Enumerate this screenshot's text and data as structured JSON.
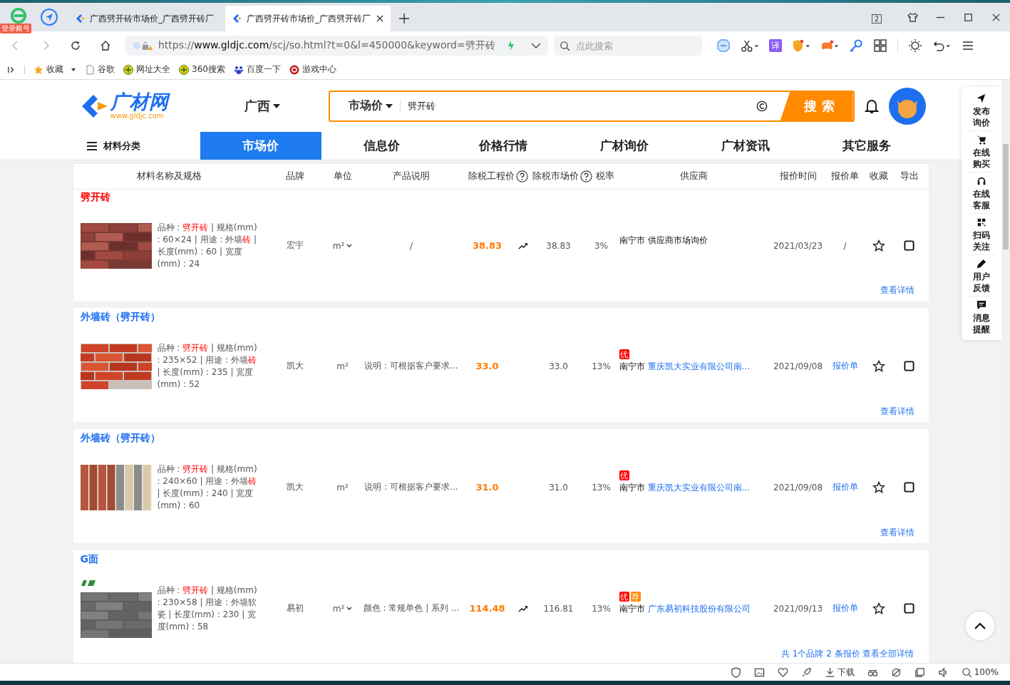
{
  "browser": {
    "login_badge": "登录账号",
    "tabs": [
      {
        "title": "广西劈开砖市场价_广西劈开砖厂",
        "selected": false
      },
      {
        "title": "广西劈开砖市场价_广西劈开砖厂",
        "selected": true
      }
    ],
    "tab_count": "2",
    "url_scheme": "https://",
    "url_host": "www.gldjc.com",
    "url_path": "/scj/so.html?t=0&l=450000&keyword=劈开砖",
    "search_placeholder": "点此搜索",
    "translate_glyph": "译",
    "bookmarks": [
      "收藏",
      "谷歌",
      "网址大全",
      "360搜索",
      "百度一下",
      "游戏中心"
    ]
  },
  "site": {
    "logo_name": "广材网",
    "logo_url": "www.gldjc.com",
    "region": "广西",
    "search_type": "市场价",
    "search_value": "劈开砖",
    "search_button": "搜 索",
    "nav": [
      {
        "label": "材料分类",
        "selected": false
      },
      {
        "label": "市场价",
        "selected": true
      },
      {
        "label": "信息价",
        "selected": false
      },
      {
        "label": "价格行情",
        "selected": false
      },
      {
        "label": "广材询价",
        "selected": false
      },
      {
        "label": "广材资讯",
        "selected": false
      },
      {
        "label": "其它服务",
        "selected": false
      }
    ]
  },
  "table": {
    "columns": [
      {
        "label": "材料名称及规格",
        "help": false
      },
      {
        "label": "品牌",
        "help": false
      },
      {
        "label": "单位",
        "help": false
      },
      {
        "label": "产品说明",
        "help": false
      },
      {
        "label": "除税工程价",
        "help": true
      },
      {
        "label": "除税市场价",
        "help": true
      },
      {
        "label": "税率",
        "help": false
      },
      {
        "label": "供应商",
        "help": false
      },
      {
        "label": "报价时间",
        "help": false
      },
      {
        "label": "报价单",
        "help": false
      },
      {
        "label": "收藏",
        "help": false
      },
      {
        "label": "导出",
        "help": false
      }
    ],
    "rows": [
      {
        "title": "劈开砖",
        "title_highlight": true,
        "brand_logo": false,
        "spec": [
          {
            "text": "品种 : ",
            "highlight": false
          },
          {
            "text": "劈开砖",
            "highlight": true
          },
          {
            "text": " | 规格(mm) : 60×24 | 用途 : 外墙",
            "highlight": false
          },
          {
            "text": "砖",
            "highlight": true
          },
          {
            "text": " | 长度(mm) : 60 | 宽度(mm) : 24",
            "highlight": false
          }
        ],
        "brand": "宏宇",
        "unit": "m²",
        "unit_dropdown": true,
        "description": "/",
        "project_price": "38.83",
        "trend": true,
        "market_price": "38.83",
        "tax_rate": "3%",
        "badges": [],
        "city": "南宁市",
        "supplier": "供应商市场询价",
        "supplier_link": false,
        "date": "2021/03/23",
        "quote": "/",
        "quote_link": false,
        "favorited": false,
        "exported": false,
        "footer": "查看详情"
      },
      {
        "title": "外墙砖（劈开砖）",
        "title_highlight": false,
        "brand_logo": false,
        "spec": [
          {
            "text": "品种 : ",
            "highlight": false
          },
          {
            "text": "劈开砖",
            "highlight": true
          },
          {
            "text": " | 规格(mm) : 235×52 | 用途 : 外墙",
            "highlight": false
          },
          {
            "text": "砖",
            "highlight": true
          },
          {
            "text": " | 长度(mm) : 235 | 宽度(mm) : 52",
            "highlight": false
          }
        ],
        "brand": "凯大",
        "unit": "m²",
        "unit_dropdown": false,
        "description": "说明 : 可根据客户要求...",
        "project_price": "33.0",
        "trend": false,
        "market_price": "33.0",
        "tax_rate": "13%",
        "badges": [
          {
            "text": "优",
            "color": "#ff0000"
          }
        ],
        "city": "南宁市",
        "supplier": "重庆凯大实业有限公司南...",
        "supplier_link": true,
        "date": "2021/09/08",
        "quote": "报价单",
        "quote_link": true,
        "favorited": false,
        "exported": false,
        "footer": "查看详情"
      },
      {
        "title": "外墙砖（劈开砖）",
        "title_highlight": false,
        "brand_logo": false,
        "spec": [
          {
            "text": "品种 : ",
            "highlight": false
          },
          {
            "text": "劈开砖",
            "highlight": true
          },
          {
            "text": " | 规格(mm) : 240×60 | 用途 : 外墙",
            "highlight": false
          },
          {
            "text": "砖",
            "highlight": true
          },
          {
            "text": " | 长度(mm) : 240 | 宽度(mm) : 60",
            "highlight": false
          }
        ],
        "brand": "凯大",
        "unit": "m²",
        "unit_dropdown": false,
        "description": "说明 : 可根据客户要求...",
        "project_price": "31.0",
        "trend": false,
        "market_price": "31.0",
        "tax_rate": "13%",
        "badges": [
          {
            "text": "优",
            "color": "#ff0000"
          }
        ],
        "city": "南宁市",
        "supplier": "重庆凯大实业有限公司南...",
        "supplier_link": true,
        "date": "2021/09/08",
        "quote": "报价单",
        "quote_link": true,
        "favorited": false,
        "exported": false,
        "footer": "查看详情"
      },
      {
        "title": "G面",
        "title_highlight": false,
        "brand_logo": true,
        "spec": [
          {
            "text": "品种 : ",
            "highlight": false
          },
          {
            "text": "劈开砖",
            "highlight": true
          },
          {
            "text": " | 规格(mm) : 230×58 | 用途 : 外墙软瓷 | 长度(mm) : 230 | 宽度(mm) : 58",
            "highlight": false
          }
        ],
        "brand": "易初",
        "unit": "m²",
        "unit_dropdown": true,
        "description": "颜色 : 常规单色 | 系列 ...",
        "project_price": "114.48",
        "trend": true,
        "market_price": "116.81",
        "tax_rate": "13%",
        "badges": [
          {
            "text": "优",
            "color": "#ff0000"
          },
          {
            "text": "荐",
            "color": "#ff8a00"
          }
        ],
        "city": "南宁市",
        "supplier": "广东易初科技股份有限公司",
        "supplier_link": true,
        "date": "2021/09/13",
        "quote": "报价单",
        "quote_link": true,
        "favorited": false,
        "exported": false,
        "footer": "共 1个品牌 2 条报价 查看全部详情"
      }
    ]
  },
  "float_bar": [
    {
      "label": "发布询价",
      "kind": "send"
    },
    {
      "label": "在线购买",
      "kind": "cart"
    },
    {
      "label": "在线客服",
      "kind": "headset"
    },
    {
      "label": "扫码关注",
      "kind": "qr"
    },
    {
      "label": "用户反馈",
      "kind": "pen"
    },
    {
      "label": "消息提醒",
      "kind": "message"
    }
  ],
  "status_bar": {
    "download": "下载",
    "zoom": "100%"
  }
}
